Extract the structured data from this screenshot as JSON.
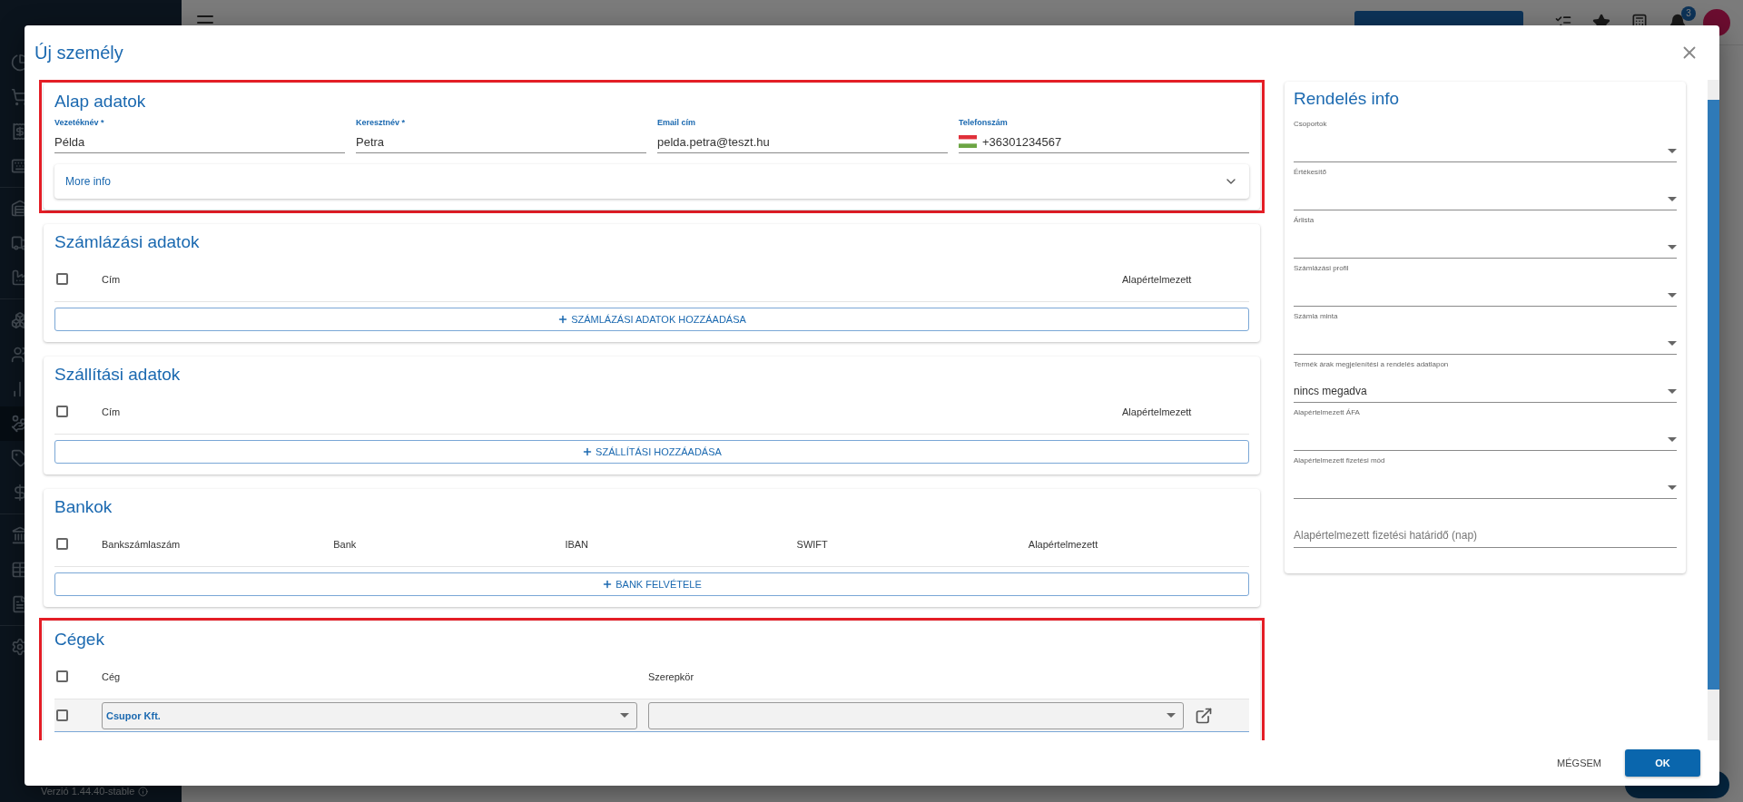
{
  "app": {
    "notification_count": "3",
    "version": "Verzió 1.44.40-stable"
  },
  "dialog": {
    "title": "Új személy",
    "sections": [
      {
        "kind": "fields",
        "title": "Alap adatok",
        "highlighted": true,
        "fields": [
          {
            "kind": "text",
            "label": "Vezetéknév *",
            "value": "Példa"
          },
          {
            "kind": "text",
            "label": "Keresztnév *",
            "value": "Petra"
          },
          {
            "kind": "text",
            "label": "Email cím",
            "value": "pelda.petra@teszt.hu"
          },
          {
            "kind": "phone",
            "label": "Telefonszám",
            "value": "+36301234567"
          }
        ],
        "expander": {
          "label": "More info",
          "expanded": false
        }
      },
      {
        "kind": "table",
        "title": "Számlázási adatok",
        "highlighted": false,
        "all_checked": false,
        "columns": [
          "Cím",
          "Alapértelmezett"
        ],
        "add_button": "SZÁMLÁZÁSI ADATOK HOZZÁADÁSA"
      },
      {
        "kind": "table",
        "title": "Szállítási adatok",
        "highlighted": false,
        "all_checked": false,
        "columns": [
          "Cím",
          "Alapértelmezett"
        ],
        "add_button": "SZÁLLÍTÁSI HOZZÁADÁSA"
      },
      {
        "kind": "table",
        "title": "Bankok",
        "highlighted": false,
        "all_checked": false,
        "columns": [
          "Bankszámlaszám",
          "Bank",
          "IBAN",
          "SWIFT",
          "Alapértelmezett"
        ],
        "add_button": "BANK FELVÉTELE"
      },
      {
        "kind": "companies",
        "title": "Cégek",
        "highlighted": true,
        "all_checked": false,
        "columns": [
          "Cég",
          "Szerepkör"
        ],
        "rows": [
          {
            "checked": false,
            "company": "Csupor Kft."
          }
        ]
      }
    ],
    "order_info": {
      "title": "Rendelés info",
      "fields": [
        {
          "kind": "select",
          "label": "Csoportok"
        },
        {
          "kind": "select",
          "label": "Értékesítő"
        },
        {
          "kind": "select",
          "label": "Árlista"
        },
        {
          "kind": "select",
          "label": "Számlázási profil"
        },
        {
          "kind": "select",
          "label": "Számla minta"
        },
        {
          "kind": "select",
          "label": "Termék árak megjelenítési a rendelés adatlapon",
          "value": "nincs megadva"
        },
        {
          "kind": "select",
          "label": "Alapértelmezett ÁFA"
        },
        {
          "kind": "select",
          "label": "Alapértelmezett fizetési mód"
        },
        {
          "kind": "input",
          "placeholder": "Alapértelmezett fizetési határidő (nap)"
        }
      ]
    },
    "buttons": [
      {
        "kind": "text",
        "label": "MÉGSEM"
      },
      {
        "kind": "primary",
        "label": "OK"
      }
    ]
  }
}
